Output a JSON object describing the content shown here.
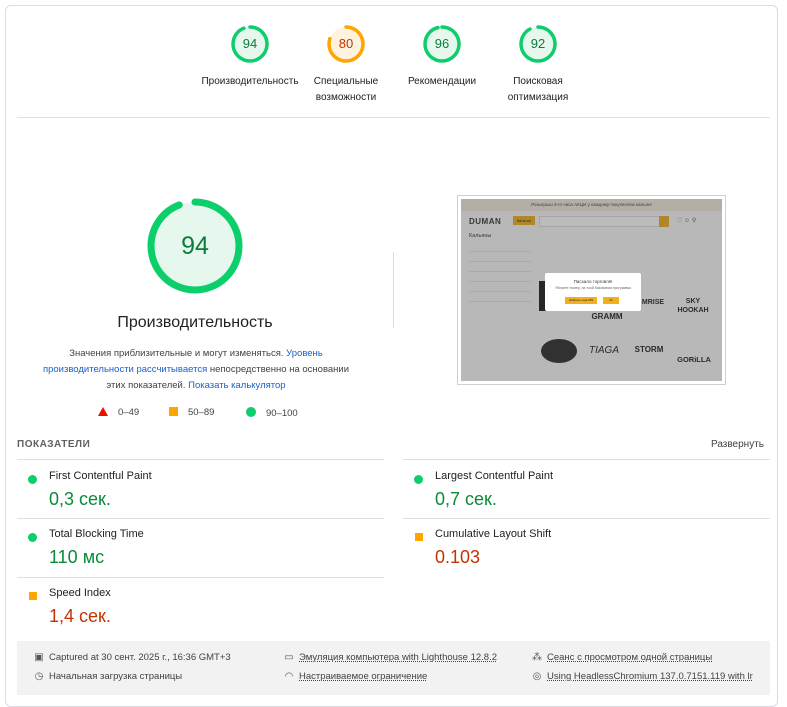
{
  "top_gauges": [
    {
      "score": "94",
      "label_lines": [
        "Производительность"
      ],
      "color": "#0cce6b",
      "text_color": "#0a7d3a",
      "bg": "#e6f8ee",
      "fraction": 0.94
    },
    {
      "score": "80",
      "label_lines": [
        "Специальные",
        "возможности"
      ],
      "color": "#ffa400",
      "text_color": "#c33300",
      "bg": "#fff3e0",
      "fraction": 0.8
    },
    {
      "score": "96",
      "label_lines": [
        "Рекомендации"
      ],
      "color": "#0cce6b",
      "text_color": "#0a7d3a",
      "bg": "#e6f8ee",
      "fraction": 0.96
    },
    {
      "score": "92",
      "label_lines": [
        "Поисковая",
        "оптимизация"
      ],
      "color": "#0cce6b",
      "text_color": "#0a7d3a",
      "bg": "#e6f8ee",
      "fraction": 0.92
    }
  ],
  "performance": {
    "score": "94",
    "fraction": 0.94,
    "title": "Производительность",
    "desc_part1": "Значения приблизительные и могут изменяться. ",
    "desc_link1": "Уровень производительности рассчитывается",
    "desc_part2": " непосредственно на основании этих показателей. ",
    "desc_link2": "Показать калькулятор"
  },
  "legend": [
    {
      "shape": "triangle",
      "range": "0–49",
      "color": "#eb0f00"
    },
    {
      "shape": "square",
      "range": "50–89",
      "color": "#ffa400"
    },
    {
      "shape": "circle",
      "range": "90–100",
      "color": "#0cce6b"
    }
  ],
  "thumbnail": {
    "banner": "Розыгрыш 3-го часа АКЦИ у каждому покупателю кальян!",
    "brand": "DUMAN",
    "catalog_btn": "Каталог",
    "catalog": "Кальяны",
    "modal_title": "Пасхало торговля!",
    "modal_sub": "Уберите номер, на тоой базования программы",
    "modal_btn1": "Набрать ещё 999",
    "modal_btn2": "Ок",
    "logos": [
      "GRAMM",
      "MRISE",
      "SKY HOOKAH",
      "TIAGA",
      "STORM",
      "GORiLLA"
    ]
  },
  "metrics": {
    "heading": "ПОКАЗАТЕЛИ",
    "expand_label": "Развернуть",
    "items": [
      {
        "name": "First Contentful Paint",
        "value": "0,3 сек.",
        "status": "good"
      },
      {
        "name": "Largest Contentful Paint",
        "value": "0,7 сек.",
        "status": "good"
      },
      {
        "name": "Total Blocking Time",
        "value": "110 мс",
        "status": "good"
      },
      {
        "name": "Cumulative Layout Shift",
        "value": "0.103",
        "status": "average"
      },
      {
        "name": "Speed Index",
        "value": "1,4 сек.",
        "status": "average"
      }
    ]
  },
  "footer": {
    "captured": "Captured at 30 сент. 2025 г., 16:36 GMT+3",
    "initial_load": "Начальная загрузка страницы",
    "emulation": "Эмуляция компьютера with Lighthouse 12.8.2",
    "throttling": "Настраиваемое ограничение",
    "session": "Сеанс с просмотром одной страницы",
    "browser": "Using HeadlessChromium 137.0.7151.119 with lr"
  },
  "colors": {
    "good": "#0cce6b",
    "average": "#ffa400",
    "fail": "#eb0f00",
    "link": "#1a5fc8"
  }
}
